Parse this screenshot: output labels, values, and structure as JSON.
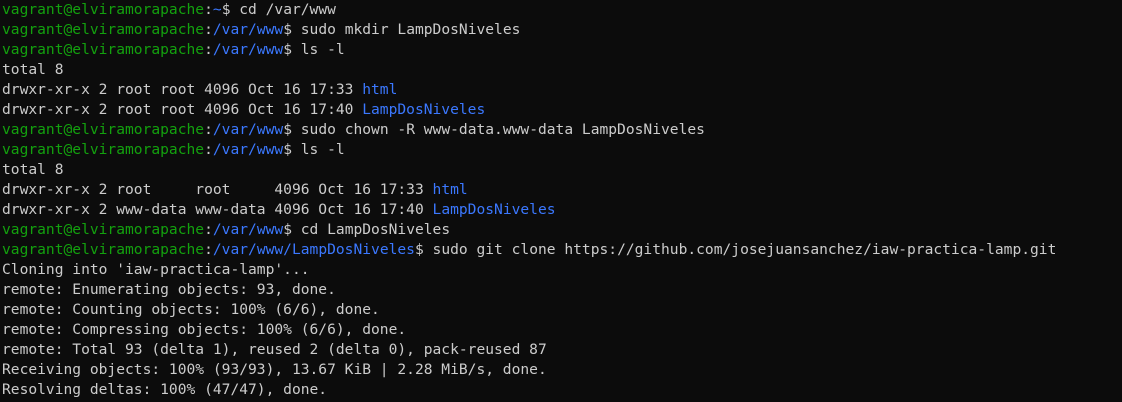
{
  "terminal": {
    "colors": {
      "background": "#0c0c0c",
      "text": "#cccccc",
      "prompt_user": "#13a10e",
      "prompt_path": "#3b78ff",
      "directory": "#3b78ff"
    },
    "lines": [
      {
        "type": "prompt",
        "user": "vagrant@elviramorapache",
        "sep": ":",
        "path": "~",
        "cmd": "$ cd /var/www"
      },
      {
        "type": "prompt",
        "user": "vagrant@elviramorapache",
        "sep": ":",
        "path": "/var/www",
        "cmd": "$ sudo mkdir LampDosNiveles"
      },
      {
        "type": "prompt",
        "user": "vagrant@elviramorapache",
        "sep": ":",
        "path": "/var/www",
        "cmd": "$ ls -l"
      },
      {
        "type": "out",
        "text": "total 8"
      },
      {
        "type": "ls",
        "text": "drwxr-xr-x 2 root root 4096 Oct 16 17:33 ",
        "name": "html"
      },
      {
        "type": "ls",
        "text": "drwxr-xr-x 2 root root 4096 Oct 16 17:40 ",
        "name": "LampDosNiveles"
      },
      {
        "type": "prompt",
        "user": "vagrant@elviramorapache",
        "sep": ":",
        "path": "/var/www",
        "cmd": "$ sudo chown -R www-data.www-data LampDosNiveles"
      },
      {
        "type": "prompt",
        "user": "vagrant@elviramorapache",
        "sep": ":",
        "path": "/var/www",
        "cmd": "$ ls -l"
      },
      {
        "type": "out",
        "text": "total 8"
      },
      {
        "type": "ls",
        "text": "drwxr-xr-x 2 root     root     4096 Oct 16 17:33 ",
        "name": "html"
      },
      {
        "type": "ls",
        "text": "drwxr-xr-x 2 www-data www-data 4096 Oct 16 17:40 ",
        "name": "LampDosNiveles"
      },
      {
        "type": "prompt",
        "user": "vagrant@elviramorapache",
        "sep": ":",
        "path": "/var/www",
        "cmd": "$ cd LampDosNiveles"
      },
      {
        "type": "prompt",
        "user": "vagrant@elviramorapache",
        "sep": ":",
        "path": "/var/www/LampDosNiveles",
        "cmd": "$ sudo git clone https://github.com/josejuansanchez/iaw-practica-lamp.git"
      },
      {
        "type": "out",
        "text": "Cloning into 'iaw-practica-lamp'..."
      },
      {
        "type": "out",
        "text": "remote: Enumerating objects: 93, done."
      },
      {
        "type": "out",
        "text": "remote: Counting objects: 100% (6/6), done."
      },
      {
        "type": "out",
        "text": "remote: Compressing objects: 100% (6/6), done."
      },
      {
        "type": "out",
        "text": "remote: Total 93 (delta 1), reused 2 (delta 0), pack-reused 87"
      },
      {
        "type": "out",
        "text": "Receiving objects: 100% (93/93), 13.67 KiB | 2.28 MiB/s, done."
      },
      {
        "type": "out",
        "text": "Resolving deltas: 100% (47/47), done."
      }
    ]
  }
}
